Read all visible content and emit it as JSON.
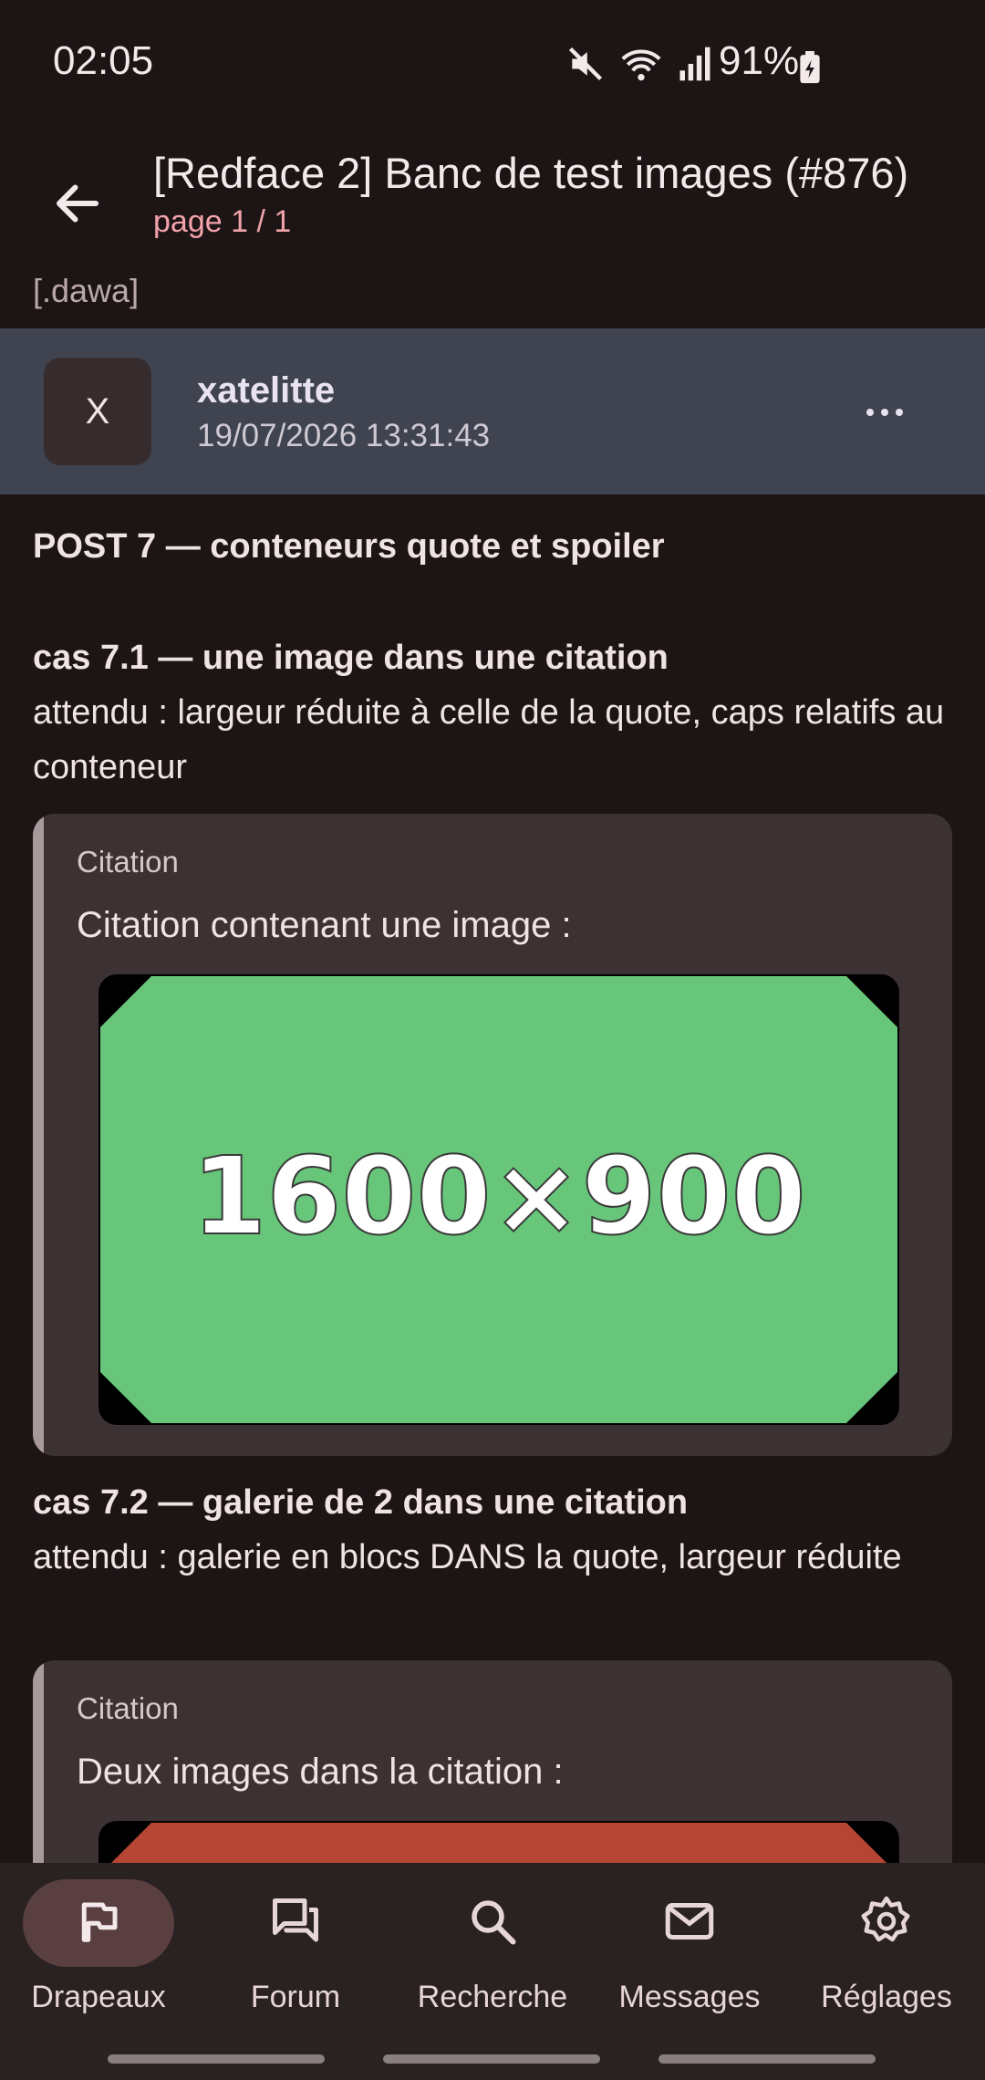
{
  "status": {
    "time": "02:05",
    "battery": "91%"
  },
  "appbar": {
    "title": "[Redface 2] Banc de test images (#876)",
    "subtitle": "page 1 / 1"
  },
  "previous_post_tail": "[.dawa]",
  "post": {
    "avatar_letter": "X",
    "author": "xatelitte",
    "date": "19/07/2026 13:31:43",
    "heading": "POST 7 — conteneurs quote et spoiler",
    "cases": [
      {
        "title": "cas 7.1 — une image dans une citation",
        "description": "attendu : largeur réduite à celle de la quote, caps relatifs au conteneur",
        "quote_label": "Citation",
        "quote_text": "Citation contenant une image :",
        "image_label": "1600×900",
        "image_color": "#67c67a"
      },
      {
        "title": "cas 7.2 — galerie de 2 dans une citation",
        "description": "attendu : galerie en blocs DANS la quote, largeur réduite",
        "quote_label": "Citation",
        "quote_text": "Deux images dans la citation :",
        "image_color": "#b74534"
      }
    ]
  },
  "nav": {
    "items": [
      {
        "label": "Drapeaux",
        "icon": "flag-icon",
        "active": true
      },
      {
        "label": "Forum",
        "icon": "forum-icon",
        "active": false
      },
      {
        "label": "Recherche",
        "icon": "search-icon",
        "active": false
      },
      {
        "label": "Messages",
        "icon": "mail-icon",
        "active": false
      },
      {
        "label": "Réglages",
        "icon": "gear-icon",
        "active": false
      }
    ]
  }
}
